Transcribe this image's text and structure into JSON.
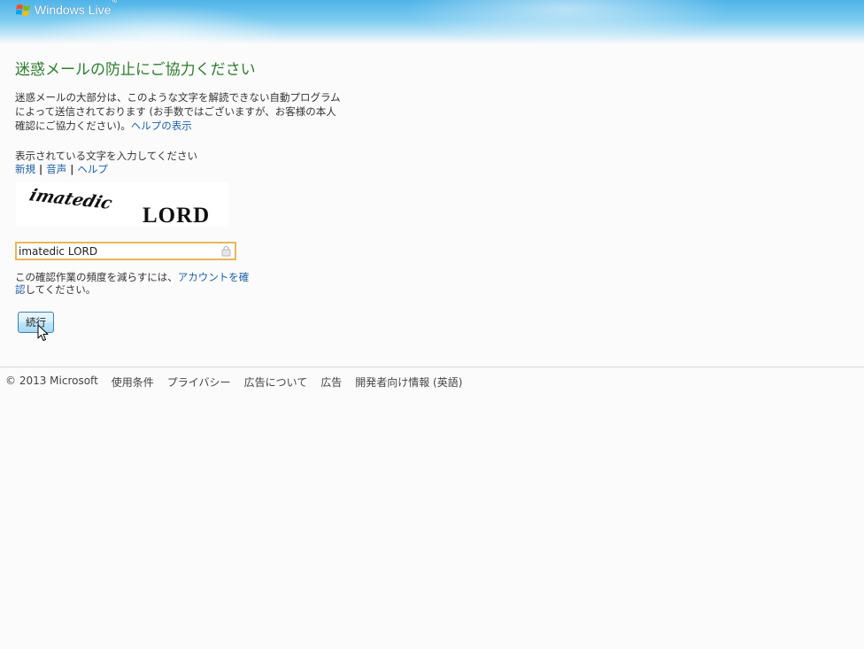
{
  "header": {
    "brand": "Windows Live",
    "trademark": "™"
  },
  "main": {
    "title": "迷惑メールの防止にご協力ください",
    "description": "迷惑メールの大部分は、このような文字を解読できない自動プログラムによって送信されております (お手数ではございますが、お客様の本人確認にご協力ください)。",
    "help_display_link": "ヘルプの表示",
    "prompt": "表示されている文字を入力してください",
    "captcha_links": {
      "new": "新規",
      "audio": "音声",
      "help": "ヘルプ",
      "separator": "|"
    },
    "captcha_words": [
      "imatedic",
      "LORD"
    ],
    "input_value": "imatedic LORD",
    "note_before": "この確認作業の頻度を減らすには、",
    "note_link": "アカウントを確認",
    "note_after": "してください。",
    "continue_label": "続行"
  },
  "footer": {
    "copyright": "© 2013 Microsoft",
    "links": [
      "使用条件",
      "プライバシー",
      "広告について",
      "広告",
      "開発者向け情報 (英語)"
    ]
  },
  "colors": {
    "title": "#2e7d2e",
    "link": "#1d5fa6",
    "input_focus_border": "#e8b75a",
    "header_blue": "#4fb3e8"
  }
}
